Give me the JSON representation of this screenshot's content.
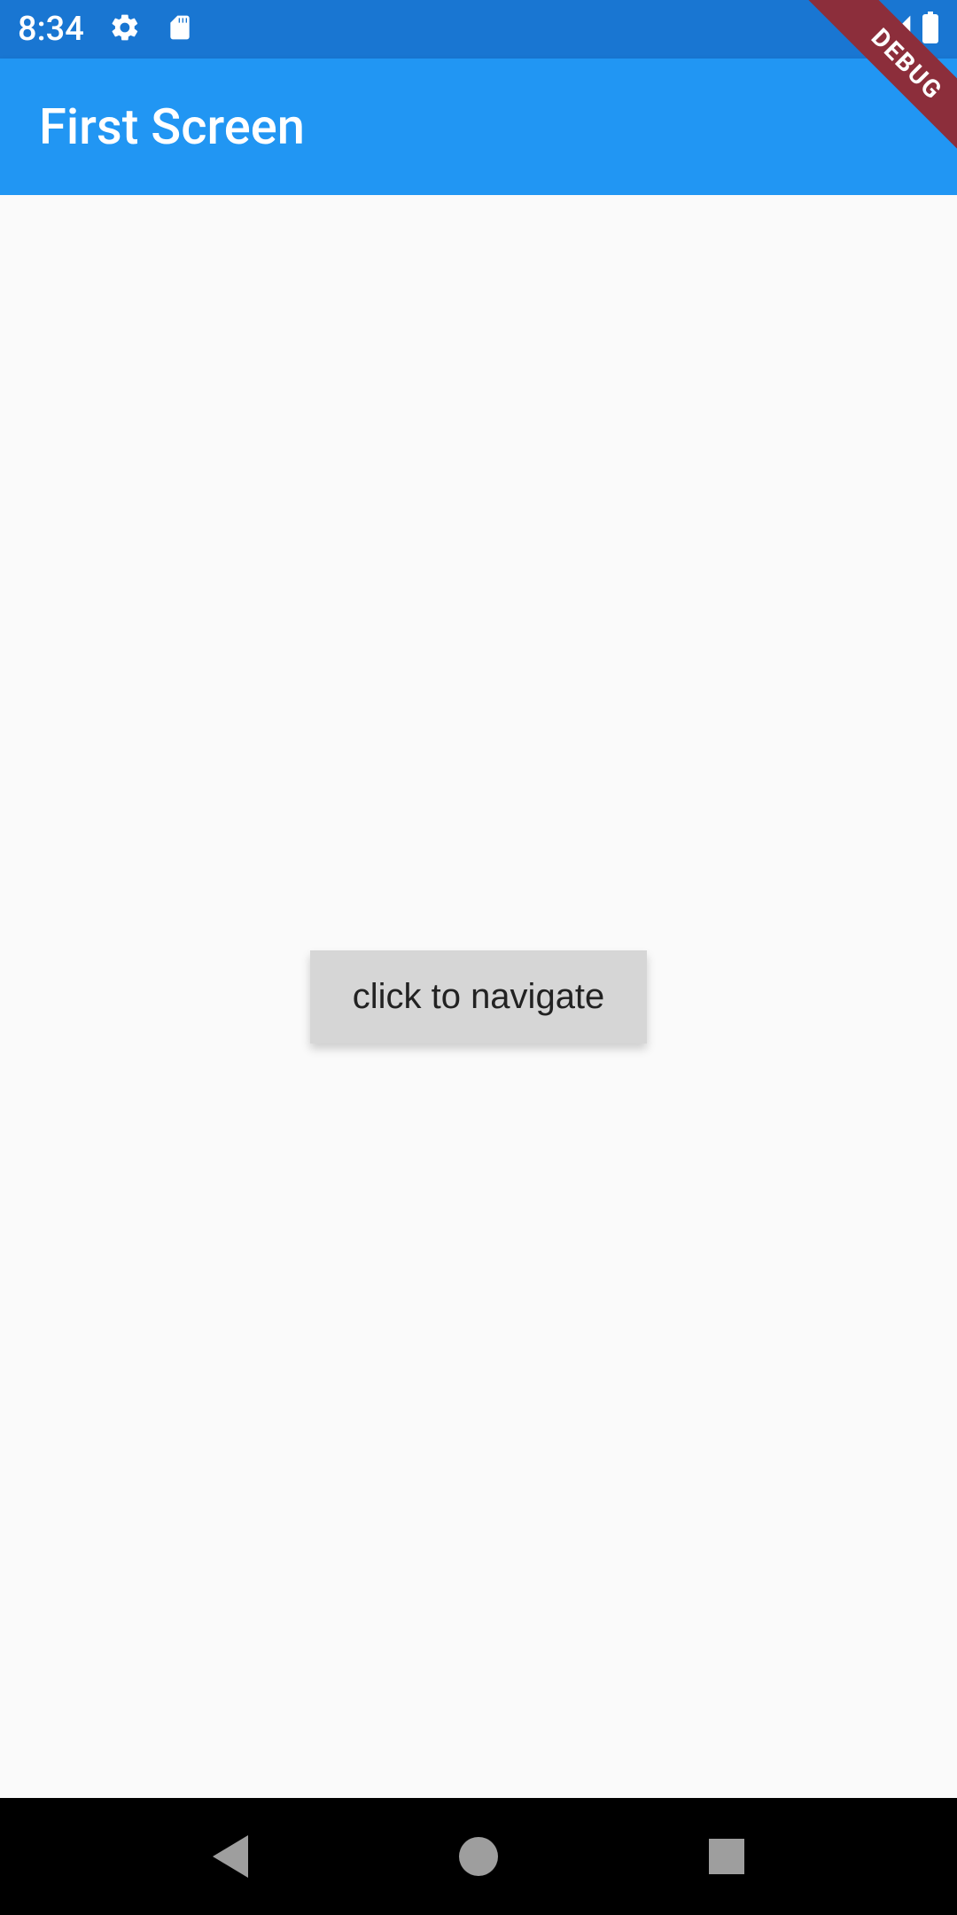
{
  "status": {
    "time": "8:34"
  },
  "appBar": {
    "title": "First Screen"
  },
  "main": {
    "button_label": "click to navigate"
  },
  "banner": {
    "text": "DEBUG"
  },
  "colors": {
    "status_bar": "#1976D2",
    "app_bar": "#2196F3",
    "button_bg": "#d6d6d6",
    "banner_bg": "#8C2E3B",
    "nav_bar": "#000000"
  }
}
